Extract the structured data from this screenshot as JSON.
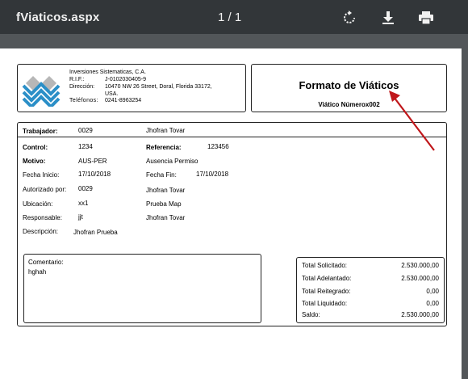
{
  "toolbar": {
    "title": "fViaticos.aspx",
    "page_indicator": "1 / 1"
  },
  "company": {
    "name": "Inversiones Sistematicas, C.A.",
    "rif_label": "R.I.F.:",
    "rif_value": "J-0102030405-9",
    "address_label": "Dirección:",
    "address_line1": "10470 NW 26 Street, Doral, Florida 33172,",
    "address_line2": "USA.",
    "phone_label": "Teléfonos:",
    "phone_value": "0241-8963254"
  },
  "header": {
    "title": "Formato de Viáticos",
    "subtitle": "Viático Númerox002"
  },
  "fields": {
    "trabajador_label": "Trabajador:",
    "trabajador_code": "0029",
    "trabajador_name": "Jhofran Tovar",
    "control_label": "Control:",
    "control_value": "1234",
    "referencia_label": "Referencia:",
    "referencia_value": "123456",
    "motivo_label": "Motivo:",
    "motivo_code": "AUS-PER",
    "motivo_desc": "Ausencia Permiso",
    "fecha_inicio_label": "Fecha Inicio:",
    "fecha_inicio_value": "17/10/2018",
    "fecha_fin_label": "Fecha Fin:",
    "fecha_fin_value": "17/10/2018",
    "autorizado_label": "Autorizado por:",
    "autorizado_code": "0029",
    "autorizado_name": "Jhofran Tovar",
    "ubicacion_label": "Ubicación:",
    "ubicacion_code": "xx1",
    "ubicacion_desc": "Prueba Map",
    "responsable_label": "Responsable:",
    "responsable_code": "jjt",
    "responsable_name": "Jhofran Tovar",
    "descripcion_label": "Descripción:",
    "descripcion_value": "Jhofran Prueba"
  },
  "comment": {
    "label": "Comentario:",
    "value": "hghah"
  },
  "totals": [
    {
      "label": "Total Solicitado:",
      "value": "2.530.000,00"
    },
    {
      "label": "Total Adelantado:",
      "value": "2.530.000,00"
    },
    {
      "label": "Total Reitegrado:",
      "value": "0,00"
    },
    {
      "label": "Total Liquidado:",
      "value": "0,00"
    },
    {
      "label": "Saldo:",
      "value": "2.530.000,00"
    }
  ],
  "colors": {
    "toolbar_bg": "#323639",
    "viewer_bg": "#525659",
    "logo_blue": "#2b8fc7",
    "logo_gray": "#b7b7b7",
    "arrow_red": "#c0171b"
  },
  "icons": [
    "rotate-icon",
    "download-icon",
    "print-icon"
  ]
}
